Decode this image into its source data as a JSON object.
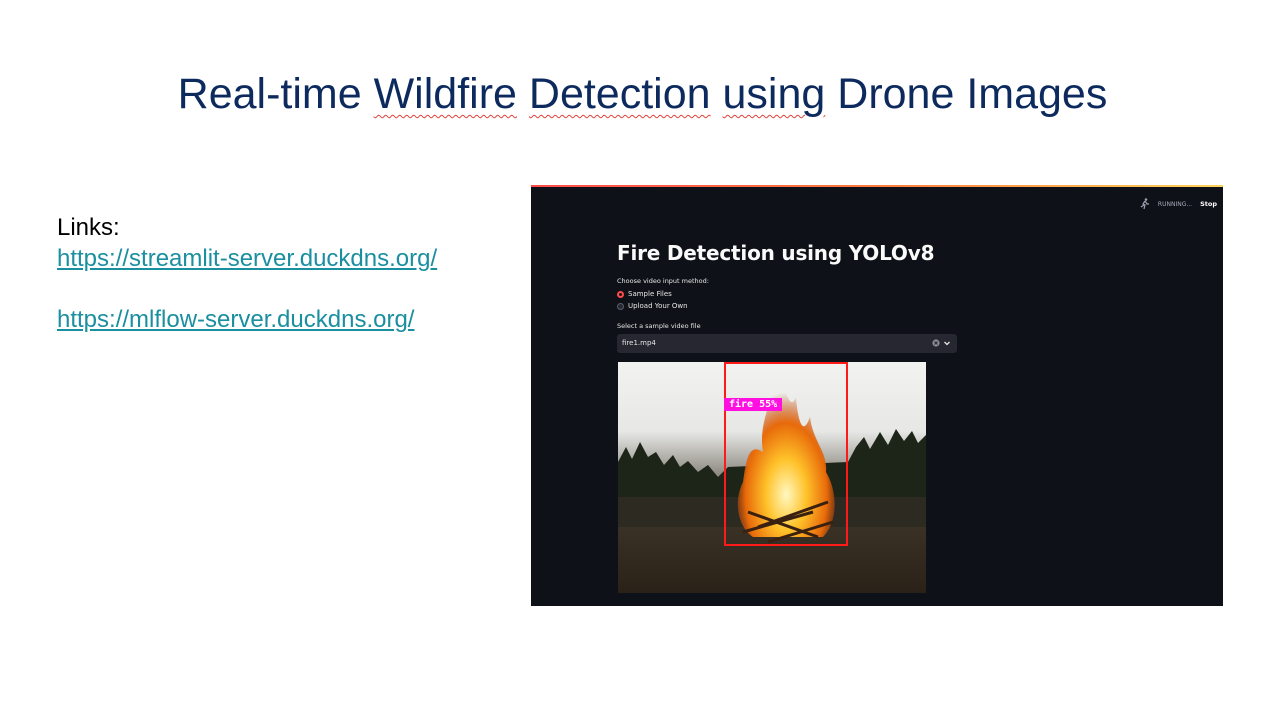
{
  "slide": {
    "title_parts": [
      "Real-time ",
      "Wildfire",
      " ",
      "Detection",
      " ",
      "using",
      " Drone Images"
    ],
    "links_label": "Links:",
    "links": [
      "https://streamlit-server.duckdns.org/",
      "https://mlflow-server.duckdns.org/"
    ]
  },
  "app": {
    "status_text": "RUNNING...",
    "stop_label": "Stop",
    "title": "Fire Detection using YOLOv8",
    "input_method_label": "Choose video input method:",
    "radio_options": [
      "Sample Files",
      "Upload Your Own"
    ],
    "selected_option": "Sample Files",
    "select_label": "Select a sample video file",
    "select_value": "fire1.mp4",
    "detection_label": "fire 55%",
    "accent_color": "#ff4b4b",
    "icons": [
      "running-person-icon",
      "clear-icon",
      "chevron-down-icon"
    ]
  }
}
